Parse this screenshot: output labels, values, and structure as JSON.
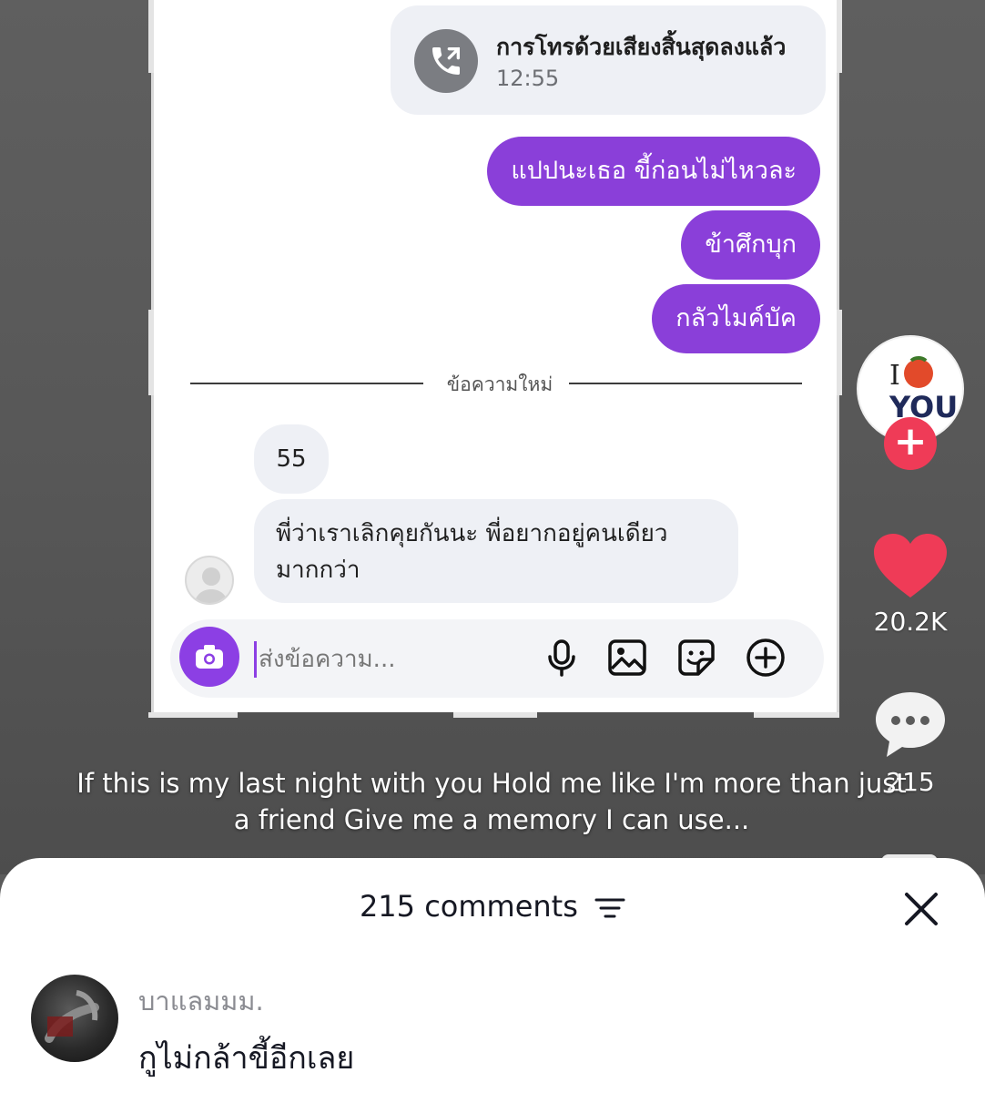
{
  "chat": {
    "call": {
      "title": "การโทรด้วยเสียงสิ้นสุดลงแล้ว",
      "time": "12:55",
      "icon": "outgoing-call-icon"
    },
    "sent_messages": [
      "แปปนะเธอ ขี้ก่อนไม่ไหวละ",
      "ข้าศึกบุก",
      "กลัวไมค์บัค"
    ],
    "divider_label": "ข้อความใหม่",
    "received_messages": [
      "55",
      "พี่ว่าเราเลิกคุยกันนะ พี่อยากอยู่คนเดียว",
      "มากกว่า"
    ],
    "composer": {
      "placeholder": "ส่งข้อความ...",
      "icons": [
        "camera-icon",
        "microphone-icon",
        "image-icon",
        "sticker-icon",
        "plus-circle-icon"
      ]
    }
  },
  "rail": {
    "avatar_text": "I ♥ YOU",
    "follow_symbol": "+",
    "likes": "20.2K",
    "comments": "215"
  },
  "caption": {
    "line1": "If this is my last night with you Hold me like I'm more than just",
    "line2": "a friend Give me a memory I can use..."
  },
  "comments_sheet": {
    "title": "215 comments",
    "close_symbol": "✕",
    "comments": [
      {
        "user": "บาแลมมม.",
        "text": "กูไม่กล้าขี้อีกเลย"
      }
    ]
  },
  "colors": {
    "outgoing_bubble": "#8a3fd9",
    "incoming_bubble": "#eef0f5",
    "like_heart": "#ef3b57",
    "follow_button": "#ef3b57"
  }
}
